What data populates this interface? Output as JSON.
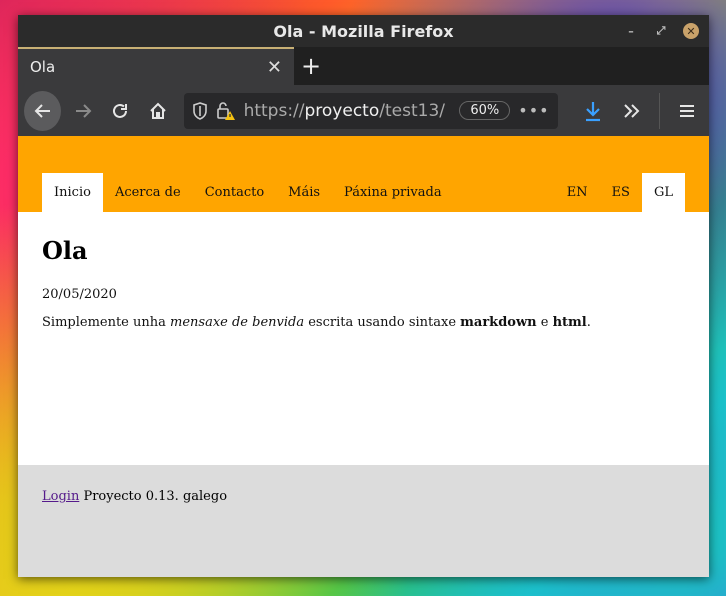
{
  "window": {
    "title": "Ola - Mozilla Firefox"
  },
  "tab": {
    "title": "Ola"
  },
  "urlbar": {
    "scheme": "https://",
    "host": "proyecto",
    "path": "/test13/",
    "zoom": "60%"
  },
  "site": {
    "nav": [
      "Inicio",
      "Acerca de",
      "Contacto",
      "Máis",
      "Páxina privada"
    ],
    "langs": [
      "EN",
      "ES",
      "GL"
    ],
    "heading": "Ola",
    "date": "20/05/2020",
    "body": {
      "t1": "Simplemente unha ",
      "em": "mensaxe de benvida",
      "t2": " escrita usando sintaxe ",
      "b1": "markdown",
      "t3": " e ",
      "b2": "html",
      "t4": "."
    },
    "footer": {
      "login": "Login",
      "text": " Proyecto 0.13. galego"
    }
  },
  "colors": {
    "header": "#ffa500",
    "footer": "#dcdcdc",
    "download": "#3aa0ff"
  },
  "icons": [
    "back-icon",
    "forward-icon",
    "reload-icon",
    "home-icon",
    "shield-icon",
    "lock-warning-icon",
    "download-icon",
    "overflow-icon",
    "menu-icon"
  ]
}
